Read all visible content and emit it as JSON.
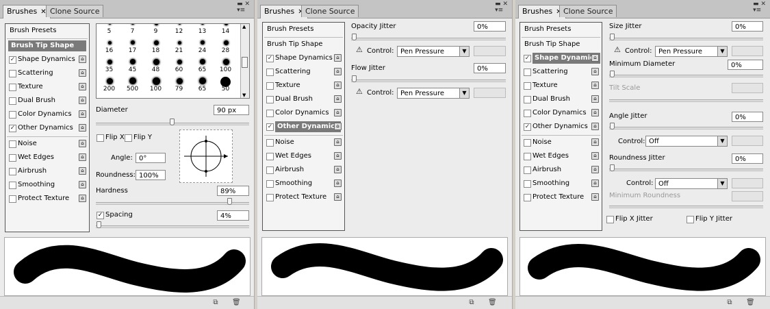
{
  "tabs": {
    "brushes": "Brushes",
    "clone_source": "Clone Source",
    "close": "✕"
  },
  "list": {
    "presets": "Brush Presets",
    "tip_shape": "Brush Tip Shape",
    "items": [
      "Shape Dynamics",
      "Scattering",
      "Texture",
      "Dual Brush",
      "Color Dynamics",
      "Other Dynamics",
      "Noise",
      "Wet Edges",
      "Airbrush",
      "Smoothing",
      "Protect Texture"
    ]
  },
  "panel1": {
    "checked": {
      "shape_dynamics": true,
      "other_dynamics": true
    },
    "tip_numbers": [
      "5",
      "7",
      "9",
      "12",
      "13",
      "14",
      "16",
      "17",
      "18",
      "21",
      "24",
      "28",
      "35",
      "45",
      "48",
      "60",
      "65",
      "100",
      "200",
      "500",
      "100",
      "79",
      "65",
      "50"
    ],
    "diameter_label": "Diameter",
    "diameter_value": "90 px",
    "diameter_level": 0.5,
    "flip_x": "Flip X",
    "flip_y": "Flip Y",
    "angle_label": "Angle:",
    "angle_value": "0°",
    "roundness_label": "Roundness:",
    "roundness_value": "100%",
    "hardness_label": "Hardness",
    "hardness_value": "89%",
    "hardness_level": 0.89,
    "spacing_label": "Spacing",
    "spacing_value": "4%",
    "spacing_checked": true
  },
  "panel2": {
    "opacity_label": "Opacity Jitter",
    "opacity_value": "0%",
    "control_label": "Control:",
    "control_value": "Pen Pressure",
    "flow_label": "Flow Jitter",
    "flow_value": "0%",
    "control2_value": "Pen Pressure"
  },
  "panel3": {
    "size_label": "Size Jitter",
    "size_value": "0%",
    "control_label": "Control:",
    "control_value": "Pen Pressure",
    "min_diam_label": "Minimum Diameter",
    "min_diam_value": "0%",
    "tilt_label": "Tilt Scale",
    "angle_label": "Angle Jitter",
    "angle_value": "0%",
    "angle_control_value": "Off",
    "roundness_label": "Roundness Jitter",
    "roundness_value": "0%",
    "roundness_control_value": "Off",
    "min_round_label": "Minimum Roundness",
    "flip_x": "Flip X Jitter",
    "flip_y": "Flip Y Jitter"
  },
  "icons": {
    "new": "new-brush-icon",
    "delete": "trash-icon",
    "lock": "lock-icon",
    "warning": "warning-icon",
    "menu": "panel-menu-icon"
  }
}
